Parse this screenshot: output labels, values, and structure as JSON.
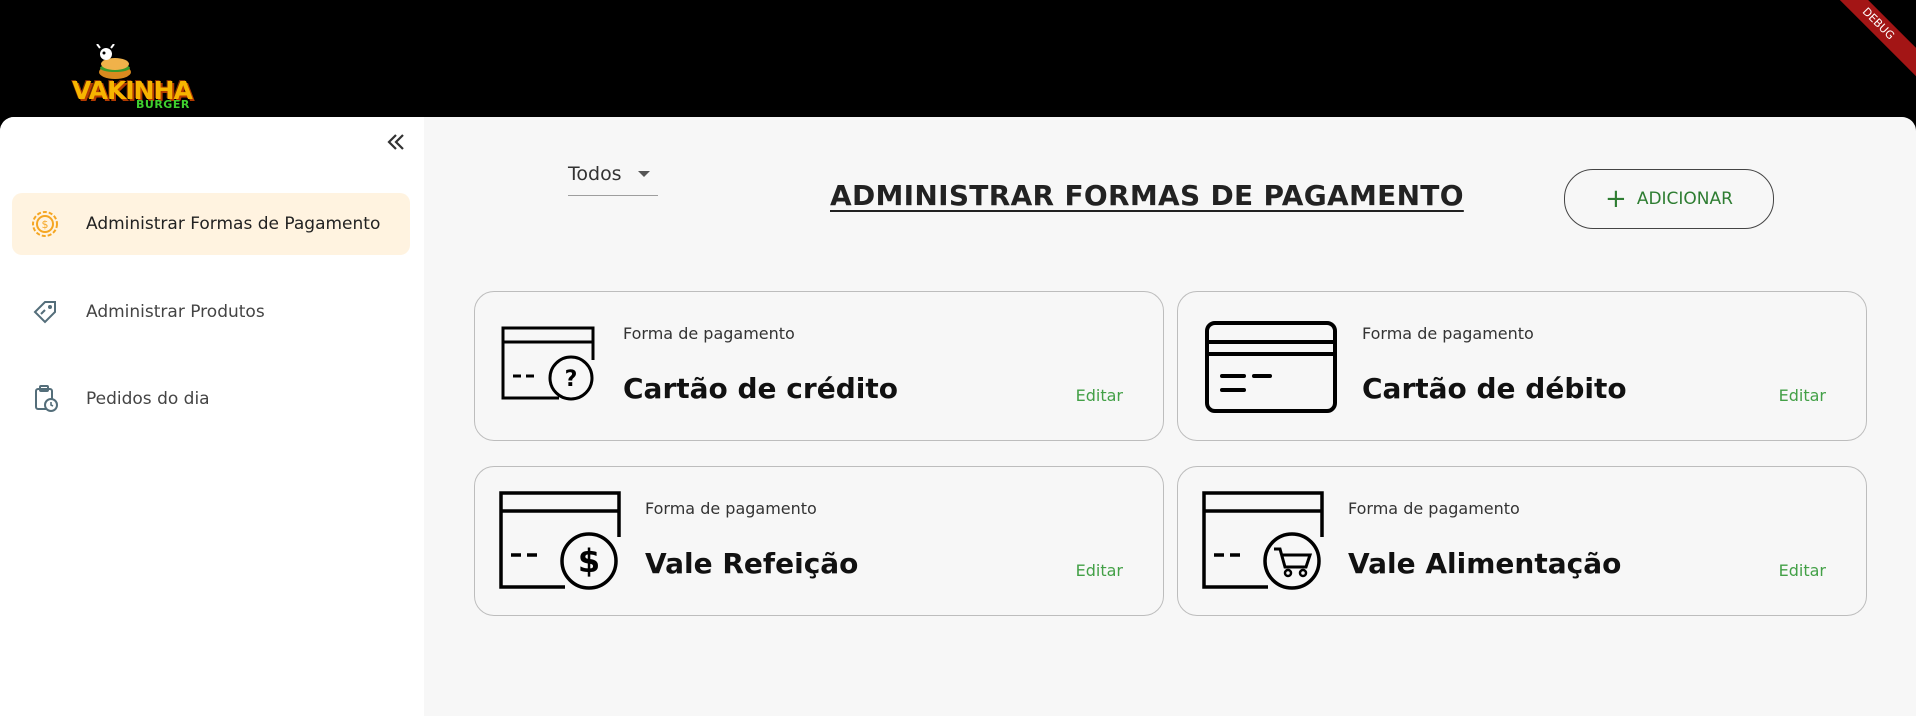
{
  "header": {
    "logo_text": "VAKINHA",
    "logo_sub": "BURGER",
    "debug_label": "DEBUG"
  },
  "sidebar": {
    "items": [
      {
        "label": "Administrar Formas de Pagamento",
        "icon": "coin-gear-icon",
        "active": true
      },
      {
        "label": "Administrar Produtos",
        "icon": "price-tag-icon",
        "active": false
      },
      {
        "label": "Pedidos do dia",
        "icon": "clipboard-clock-icon",
        "active": false
      }
    ]
  },
  "main": {
    "filter_value": "Todos",
    "title": "ADMINISTRAR FORMAS DE PAGAMENTO",
    "add_label": "ADICIONAR",
    "cards": [
      {
        "caption": "Forma de pagamento",
        "name": "Cartão de crédito",
        "edit": "Editar",
        "icon": "credit-card-question-icon"
      },
      {
        "caption": "Forma de pagamento",
        "name": "Cartão de débito",
        "edit": "Editar",
        "icon": "debit-card-icon"
      },
      {
        "caption": "Forma de pagamento",
        "name": "Vale Refeição",
        "edit": "Editar",
        "icon": "card-dollar-icon"
      },
      {
        "caption": "Forma de pagamento",
        "name": "Vale Alimentação",
        "edit": "Editar",
        "icon": "card-cart-icon"
      }
    ]
  },
  "colors": {
    "accent_green": "#43a047",
    "active_nav_bg": "#fff3e0",
    "icon_orange": "#f5a623"
  }
}
